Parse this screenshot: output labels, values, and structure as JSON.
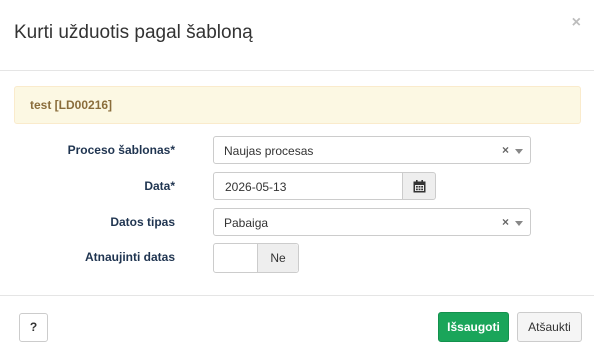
{
  "modal": {
    "title": "Kurti užduotis pagal šabloną",
    "close_glyph": "×"
  },
  "alert": {
    "text": "test [LD00216]",
    "color": "#fcf8e3"
  },
  "form": {
    "process_template": {
      "label": "Proceso šablonas*",
      "value": "Naujas procesas",
      "clear_glyph": "×"
    },
    "date": {
      "label": "Data*",
      "value": "2026-05-13",
      "icon": "calendar-icon"
    },
    "date_type": {
      "label": "Datos tipas",
      "value": "Pabaiga",
      "clear_glyph": "×"
    },
    "update_dates": {
      "label": "Atnaujinti datas",
      "state_label": "Ne"
    }
  },
  "footer": {
    "help_label": "?",
    "save_label": "Išsaugoti",
    "cancel_label": "Atšaukti",
    "save_color": "#1aa55a"
  }
}
